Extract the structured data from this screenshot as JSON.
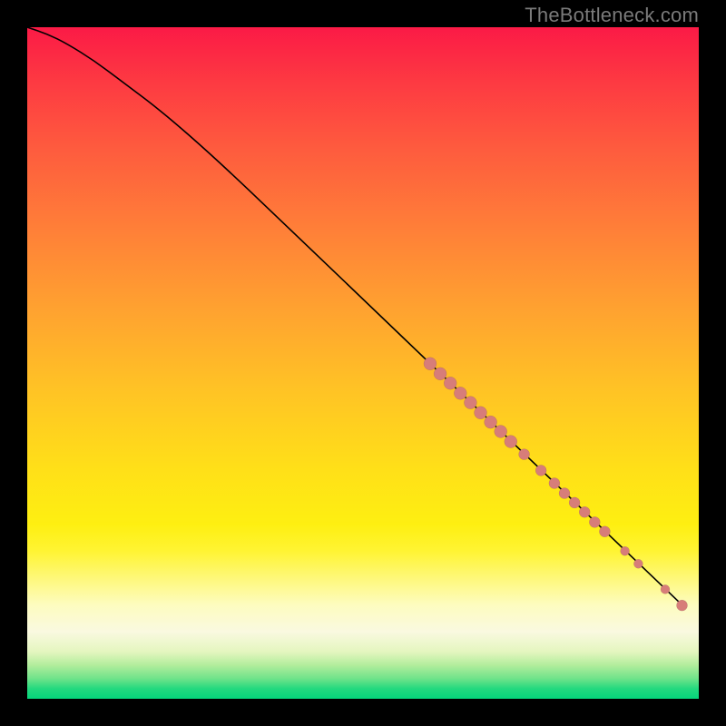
{
  "watermark": "TheBottleneck.com",
  "chart_data": {
    "type": "line",
    "title": "",
    "xlabel": "",
    "ylabel": "",
    "xlim": [
      0,
      100
    ],
    "ylim": [
      0,
      100
    ],
    "grid": false,
    "legend": false,
    "curve": {
      "name": "curve",
      "x": [
        0,
        3,
        6,
        10,
        14,
        20,
        28,
        38,
        50,
        62,
        74,
        86,
        98
      ],
      "y": [
        100,
        99,
        97.5,
        95,
        92,
        87.5,
        80.5,
        71,
        59.5,
        48,
        36.5,
        25,
        13.5
      ]
    },
    "markers": {
      "name": "points",
      "x": [
        60,
        61.5,
        63,
        64.5,
        66,
        67.5,
        69,
        70.5,
        72,
        74,
        76.5,
        78.5,
        80,
        81.5,
        83,
        84.5,
        86,
        89,
        91,
        95,
        97.5
      ],
      "y": [
        49.9,
        48.4,
        47.0,
        45.5,
        44.1,
        42.6,
        41.2,
        39.8,
        38.3,
        36.4,
        34.0,
        32.1,
        30.6,
        29.2,
        27.8,
        26.3,
        24.9,
        22.0,
        20.1,
        16.3,
        13.9
      ],
      "r": [
        7,
        7,
        7,
        7,
        7,
        7,
        7,
        7,
        7,
        6,
        6,
        6,
        6,
        6,
        6,
        6,
        6,
        5,
        5,
        5,
        6
      ]
    },
    "colors": {
      "curve": "#000000",
      "marker": "#d77d79",
      "gradient_top": "#fb1a46",
      "gradient_mid": "#ffe018",
      "gradient_bottom": "#05d57b"
    }
  }
}
